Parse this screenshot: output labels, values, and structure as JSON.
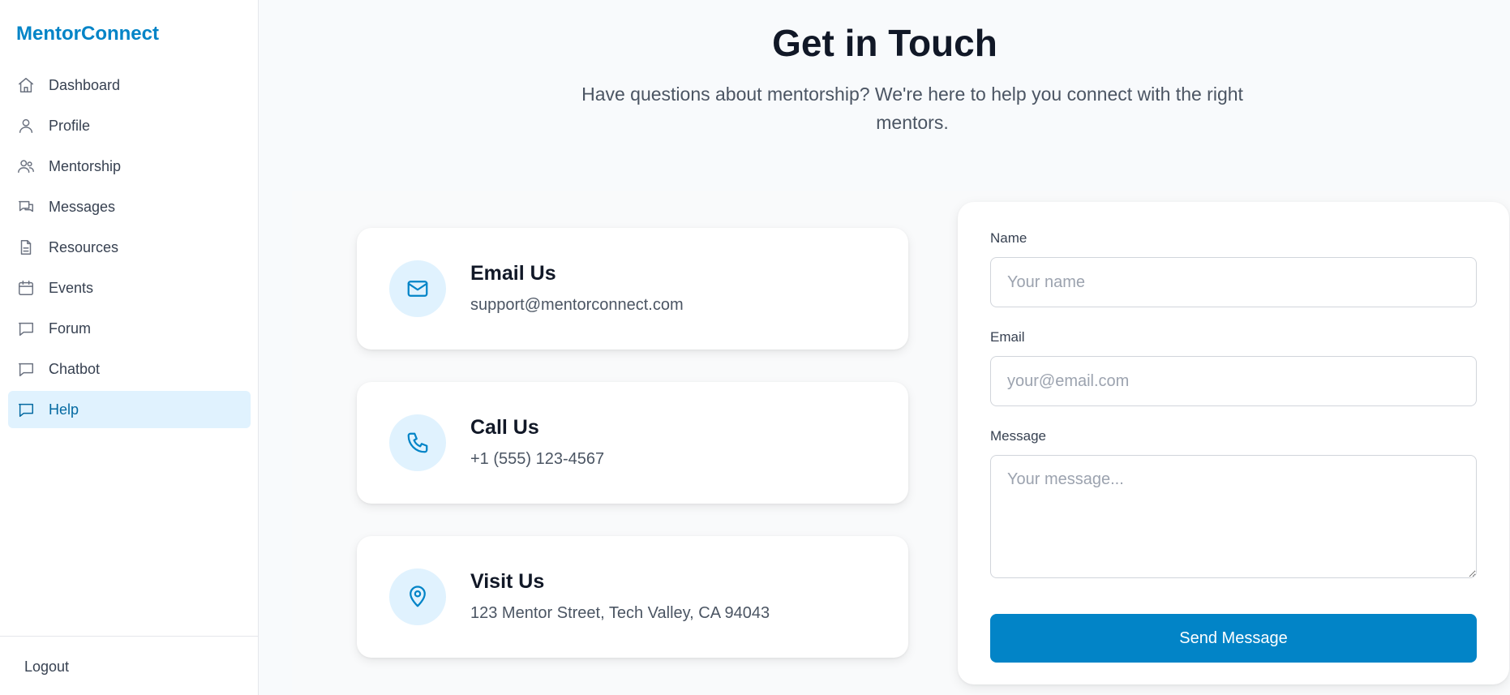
{
  "brand": "MentorConnect",
  "sidebar": {
    "items": [
      {
        "label": "Dashboard",
        "icon": "home-icon"
      },
      {
        "label": "Profile",
        "icon": "user-icon"
      },
      {
        "label": "Mentorship",
        "icon": "users-icon"
      },
      {
        "label": "Messages",
        "icon": "messages-icon"
      },
      {
        "label": "Resources",
        "icon": "document-icon"
      },
      {
        "label": "Events",
        "icon": "calendar-icon"
      },
      {
        "label": "Forum",
        "icon": "chat-bubble-icon"
      },
      {
        "label": "Chatbot",
        "icon": "chat-bubble-icon"
      },
      {
        "label": "Help",
        "icon": "chat-bubble-icon"
      }
    ],
    "active_item": "Help",
    "logout_label": "Logout"
  },
  "header": {
    "title": "Get in Touch",
    "subtitle": "Have questions about mentorship? We're here to help you connect with the right mentors."
  },
  "contact_cards": [
    {
      "title": "Email Us",
      "detail": "support@mentorconnect.com",
      "icon": "mail-icon"
    },
    {
      "title": "Call Us",
      "detail": "+1 (555) 123-4567",
      "icon": "phone-icon"
    },
    {
      "title": "Visit Us",
      "detail": "123 Mentor Street, Tech Valley, CA 94043",
      "icon": "map-pin-icon"
    }
  ],
  "form": {
    "name_label": "Name",
    "name_placeholder": "Your name",
    "email_label": "Email",
    "email_placeholder": "your@email.com",
    "message_label": "Message",
    "message_placeholder": "Your message...",
    "submit_label": "Send Message"
  },
  "colors": {
    "accent": "#0284c7",
    "accent_light": "#e0f2fe",
    "active_text": "#0369a1",
    "page_background": "#f8fafc"
  }
}
